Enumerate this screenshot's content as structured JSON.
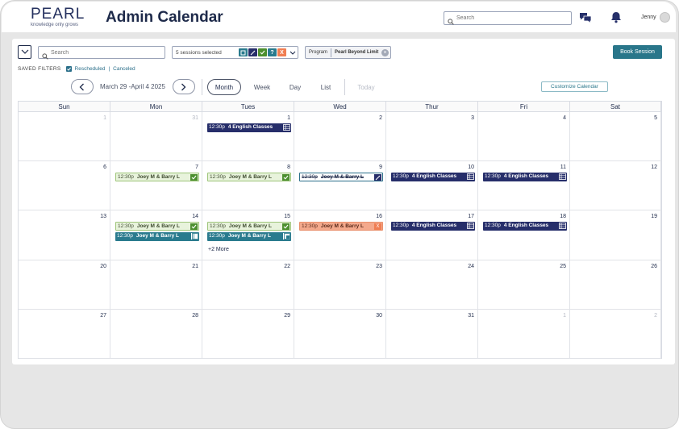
{
  "header": {
    "logo_word": "PEARL",
    "logo_tagline": "knowledge only grows",
    "title": "Admin Calendar",
    "search_placeholder": "Search",
    "user_name": "Jenny"
  },
  "toolbar": {
    "search_placeholder": "Search",
    "sessions_selected": "5 sessions selected",
    "session_type_icons": [
      {
        "name": "classroom-icon",
        "color": "#2a7b8e"
      },
      {
        "name": "rescheduled-icon",
        "color": "#262e6a"
      },
      {
        "name": "completed-icon",
        "color": "#4c8f2f"
      },
      {
        "name": "question-icon",
        "color": "#2a7b8e",
        "glyph": "?"
      },
      {
        "name": "canceled-icon",
        "color": "#f07e53",
        "glyph": "X"
      }
    ],
    "program_label": "Program",
    "program_value": "Pearl Beyond Limit",
    "book_button": "Book Session"
  },
  "saved_filters": {
    "label": "SAVED FILTERS",
    "items": [
      "Rescheduled",
      "Canceled"
    ]
  },
  "navigation": {
    "range": "March 29 -April 4 2025",
    "views": [
      "Month",
      "Week",
      "Day",
      "List"
    ],
    "active_view": "Month",
    "today": "Today",
    "customize": "Customize Calendar"
  },
  "calendar": {
    "days_of_week": [
      "Sun",
      "Mon",
      "Tues",
      "Wed",
      "Thur",
      "Fri",
      "Sat"
    ],
    "weeks": [
      [
        {
          "day": "1",
          "muted": true,
          "events": []
        },
        {
          "day": "31",
          "muted": true,
          "events": []
        },
        {
          "day": "1",
          "events": [
            {
              "time": "12:30p",
              "title": "4 English Classes",
              "style": "navy",
              "icon": "list"
            }
          ]
        },
        {
          "day": "2",
          "events": []
        },
        {
          "day": "3",
          "events": []
        },
        {
          "day": "4",
          "events": []
        },
        {
          "day": "5",
          "events": []
        }
      ],
      [
        {
          "day": "6",
          "events": []
        },
        {
          "day": "7",
          "events": [
            {
              "time": "12:30p",
              "title": "Joey M & Barry L",
              "style": "green",
              "icon": "check"
            }
          ]
        },
        {
          "day": "8",
          "events": [
            {
              "time": "12:30p",
              "title": "Joey M & Barry L",
              "style": "green",
              "icon": "check"
            }
          ]
        },
        {
          "day": "9",
          "events": [
            {
              "time": "12:30p",
              "title": "Joey M & Barry L",
              "style": "resched",
              "icon": "slash"
            }
          ]
        },
        {
          "day": "10",
          "events": [
            {
              "time": "12:30p",
              "title": "4 English Classes",
              "style": "navy",
              "icon": "list"
            }
          ]
        },
        {
          "day": "11",
          "events": [
            {
              "time": "12:30p",
              "title": "4 English Classes",
              "style": "navy",
              "icon": "list"
            }
          ]
        },
        {
          "day": "12",
          "events": []
        }
      ],
      [
        {
          "day": "13",
          "events": []
        },
        {
          "day": "14",
          "events": [
            {
              "time": "12:30p",
              "title": "Joey M & Barry L",
              "style": "green",
              "icon": "check"
            },
            {
              "time": "12:30p",
              "title": "Joey M & Barry L",
              "style": "teal",
              "icon": "board"
            }
          ]
        },
        {
          "day": "15",
          "events": [
            {
              "time": "12:30p",
              "title": "Joey M & Barry L",
              "style": "green",
              "icon": "check"
            },
            {
              "time": "12:30p",
              "title": "Joey M & Barry L",
              "style": "teal",
              "icon": "board2"
            }
          ],
          "more": "+2 More"
        },
        {
          "day": "16",
          "events": [
            {
              "time": "12:30p",
              "title": "Joey M & Barry L",
              "style": "cancel",
              "icon": "x"
            }
          ]
        },
        {
          "day": "17",
          "events": [
            {
              "time": "12:30p",
              "title": "4 English Classes",
              "style": "navy",
              "icon": "list"
            }
          ]
        },
        {
          "day": "18",
          "events": [
            {
              "time": "12:30p",
              "title": "4 English Classes",
              "style": "navy",
              "icon": "list"
            }
          ]
        },
        {
          "day": "19",
          "events": []
        }
      ],
      [
        {
          "day": "20",
          "events": []
        },
        {
          "day": "21",
          "events": []
        },
        {
          "day": "22",
          "events": []
        },
        {
          "day": "23",
          "events": []
        },
        {
          "day": "24",
          "events": []
        },
        {
          "day": "25",
          "events": []
        },
        {
          "day": "26",
          "events": []
        }
      ],
      [
        {
          "day": "27",
          "events": []
        },
        {
          "day": "28",
          "events": []
        },
        {
          "day": "29",
          "events": []
        },
        {
          "day": "30",
          "events": []
        },
        {
          "day": "31",
          "events": []
        },
        {
          "day": "1",
          "muted": true,
          "events": []
        },
        {
          "day": "2",
          "muted": true,
          "events": []
        }
      ]
    ]
  },
  "colors": {
    "brand_teal": "#29768a",
    "navy": "#262e6a",
    "completed_green": "#4c8f2f",
    "canceled_orange": "#f07e53"
  }
}
